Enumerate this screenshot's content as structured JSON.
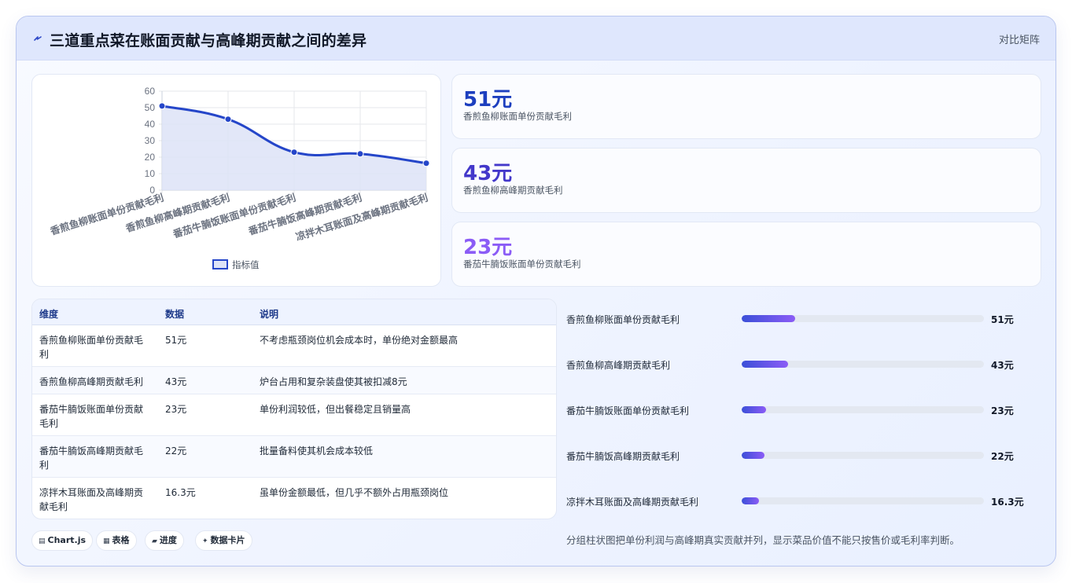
{
  "header": {
    "title": "三道重点菜在账面贡献与高峰期贡献之间的差异",
    "tag": "对比矩阵"
  },
  "chart_data": {
    "type": "line",
    "categories": [
      "香煎鱼柳账面单份贡献毛利",
      "香煎鱼柳高峰期贡献毛利",
      "番茄牛腩饭账面单份贡献毛利",
      "番茄牛腩饭高峰期贡献毛利",
      "凉拌木耳账面及高峰期贡献毛利"
    ],
    "series": [
      {
        "name": "指标值",
        "values": [
          51,
          43,
          23,
          22,
          16.3
        ]
      }
    ],
    "ylim": [
      0,
      60
    ],
    "yticks": [
      "0",
      "10",
      "20",
      "30",
      "40",
      "50",
      "60"
    ],
    "area_fill": true,
    "grid": true,
    "legend": "bottom",
    "colors": {
      "line": "#2546c9",
      "fill": "#dde3f7"
    }
  },
  "stats": [
    {
      "value": "51元",
      "label": "香煎鱼柳账面单份贡献毛利",
      "color": "#1d3fbf"
    },
    {
      "value": "43元",
      "label": "香煎鱼柳高峰期贡献毛利",
      "color": "#4338ca"
    },
    {
      "value": "23元",
      "label": "番茄牛腩饭账面单份贡献毛利",
      "color": "#8b5cf6"
    }
  ],
  "table": {
    "headers": [
      "维度",
      "数据",
      "说明"
    ],
    "rows": [
      {
        "dim": "香煎鱼柳账面单份贡献毛利",
        "data": "51元",
        "note": "不考虑瓶颈岗位机会成本时，单份绝对金额最高"
      },
      {
        "dim": "香煎鱼柳高峰期贡献毛利",
        "data": "43元",
        "note": "炉台占用和复杂装盘使其被扣减8元"
      },
      {
        "dim": "番茄牛腩饭账面单份贡献毛利",
        "data": "23元",
        "note": "单份利润较低，但出餐稳定且销量高"
      },
      {
        "dim": "番茄牛腩饭高峰期贡献毛利",
        "data": "22元",
        "note": "批量备料使其机会成本较低"
      },
      {
        "dim": "凉拌木耳账面及高峰期贡献毛利",
        "data": "16.3元",
        "note": "虽单份金额最低，但几乎不额外占用瓶颈岗位"
      }
    ]
  },
  "progress": [
    {
      "label": "香煎鱼柳账面单份贡献毛利",
      "value_text": "51元",
      "fraction": 0.22
    },
    {
      "label": "香煎鱼柳高峰期贡献毛利",
      "value_text": "43元",
      "fraction": 0.19
    },
    {
      "label": "番茄牛腩饭账面单份贡献毛利",
      "value_text": "23元",
      "fraction": 0.1
    },
    {
      "label": "番茄牛腩饭高峰期贡献毛利",
      "value_text": "22元",
      "fraction": 0.095
    },
    {
      "label": "凉拌木耳账面及高峰期贡献毛利",
      "value_text": "16.3元",
      "fraction": 0.07
    }
  ],
  "chips": [
    {
      "icon": "chart-icon",
      "label": "Chart.js"
    },
    {
      "icon": "table-icon",
      "label": "表格"
    },
    {
      "icon": "progress-icon",
      "label": "进度"
    },
    {
      "icon": "sparkle-icon",
      "label": "数据卡片"
    }
  ],
  "note": "分组柱状图把单份利润与高峰期真实贡献并列，显示菜品价值不能只按售价或毛利率判断。"
}
